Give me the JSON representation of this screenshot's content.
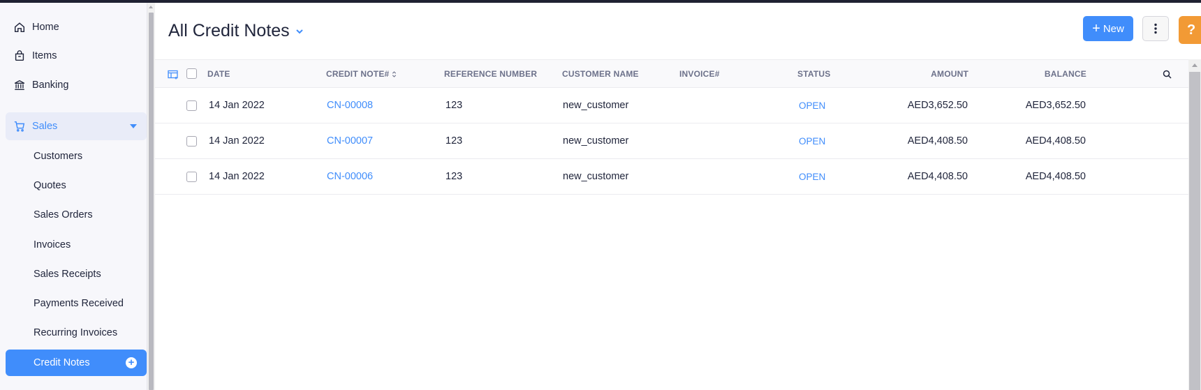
{
  "sidebar": {
    "home": "Home",
    "items": "Items",
    "banking": "Banking",
    "sales": "Sales",
    "sub": [
      "Customers",
      "Quotes",
      "Sales Orders",
      "Invoices",
      "Sales Receipts",
      "Payments Received",
      "Recurring Invoices",
      "Credit Notes"
    ]
  },
  "header": {
    "title": "All Credit Notes",
    "new_label": "New",
    "help_label": "?"
  },
  "table": {
    "columns": {
      "date": "DATE",
      "credit_note": "CREDIT NOTE#",
      "reference": "REFERENCE NUMBER",
      "customer": "CUSTOMER NAME",
      "invoice": "INVOICE#",
      "status": "STATUS",
      "amount": "AMOUNT",
      "balance": "BALANCE"
    },
    "rows": [
      {
        "date": "14 Jan 2022",
        "credit_note": "CN-00008",
        "reference": "123",
        "customer": "new_customer",
        "invoice": "",
        "status": "OPEN",
        "amount": "AED3,652.50",
        "balance": "AED3,652.50"
      },
      {
        "date": "14 Jan 2022",
        "credit_note": "CN-00007",
        "reference": "123",
        "customer": "new_customer",
        "invoice": "",
        "status": "OPEN",
        "amount": "AED4,408.50",
        "balance": "AED4,408.50"
      },
      {
        "date": "14 Jan 2022",
        "credit_note": "CN-00006",
        "reference": "123",
        "customer": "new_customer",
        "invoice": "",
        "status": "OPEN",
        "amount": "AED4,408.50",
        "balance": "AED4,408.50"
      }
    ]
  },
  "colors": {
    "accent": "#408dfb",
    "help": "#f29a35",
    "topbar": "#1f2132"
  },
  "icons": [
    "home-icon",
    "items-icon",
    "bank-icon",
    "cart-icon",
    "chevron-down-icon",
    "plus-circle-icon",
    "more-vertical-icon",
    "columns-icon",
    "search-icon",
    "sort-icon"
  ]
}
